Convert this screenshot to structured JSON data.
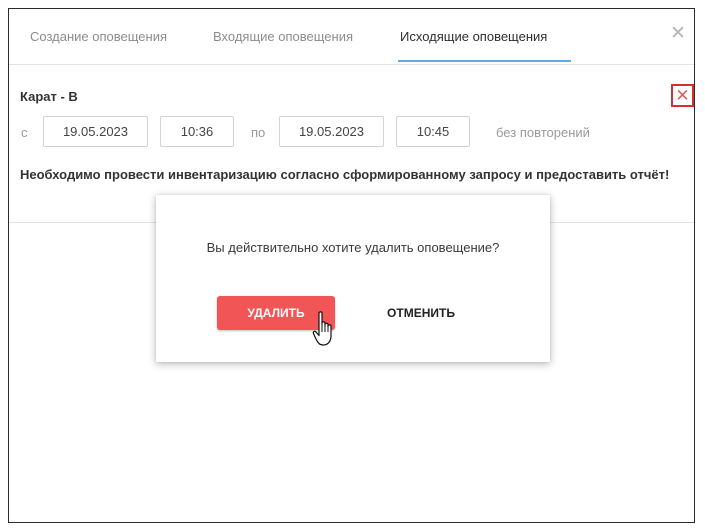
{
  "tabs": [
    {
      "label": "Создание оповещения"
    },
    {
      "label": "Входящие оповещения"
    },
    {
      "label": "Исходящие оповещения"
    }
  ],
  "close_window": {
    "glyph": "✕",
    "icon": "close-icon"
  },
  "notification": {
    "title": "Карат - В",
    "delete_glyph": "✕",
    "from_label": "с",
    "date_from": "19.05.2023",
    "time_from": "10:36",
    "to_label": "по",
    "date_to": "19.05.2023",
    "time_to": "10:45",
    "repeat": "без повторений",
    "message": "Необходимо провести инвентаризацию согласно сформированному запросу и предоставить отчёт!"
  },
  "dialog": {
    "text": "Вы действительно хотите удалить оповещение?",
    "confirm_label": "УДАЛИТЬ",
    "cancel_label": "ОТМЕНИТЬ"
  },
  "colors": {
    "delete_button": "#f25555",
    "delete_highlight_border": "#d62f2f",
    "active_tab_underline": "#64a8e6"
  }
}
